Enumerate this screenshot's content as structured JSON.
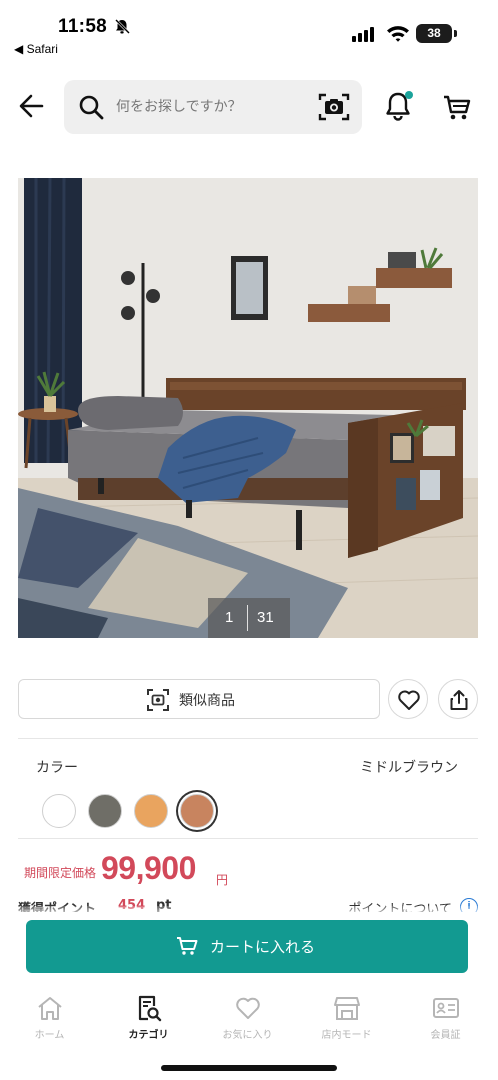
{
  "status_bar": {
    "time": "11:58",
    "back_app": "◀ Safari",
    "battery": "38"
  },
  "header": {
    "search_placeholder": "何をお探しですか？"
  },
  "gallery": {
    "current": "1",
    "total": "31"
  },
  "actions": {
    "similar_label": "類似商品"
  },
  "color": {
    "title": "カラー",
    "selected_name": "ミドルブラウン",
    "swatches": [
      {
        "name": "white",
        "hex": "#ffffff"
      },
      {
        "name": "gray",
        "hex": "#6f6e67"
      },
      {
        "name": "light-brown",
        "hex": "#e9a45f"
      },
      {
        "name": "middle-brown",
        "hex": "#c8845f",
        "selected": true
      }
    ]
  },
  "price": {
    "label": "期間限定価格",
    "value": "99,900",
    "unit": "円"
  },
  "points": {
    "label": "獲得ポイント",
    "value": "454",
    "unit": "pt",
    "link": "ポイントについて"
  },
  "cart_button": {
    "label": "カートに入れる"
  },
  "tabbar": {
    "items": [
      {
        "label": "ホーム",
        "icon": "home-icon"
      },
      {
        "label": "カテゴリ",
        "icon": "category-search-icon",
        "active": true
      },
      {
        "label": "お気に入り",
        "icon": "heart-icon"
      },
      {
        "label": "店内モード",
        "icon": "store-icon"
      },
      {
        "label": "会員証",
        "icon": "member-card-icon"
      }
    ]
  },
  "colors": {
    "accent": "#129a91",
    "price": "#d2495a",
    "notification_dot": "#1ba39b"
  }
}
